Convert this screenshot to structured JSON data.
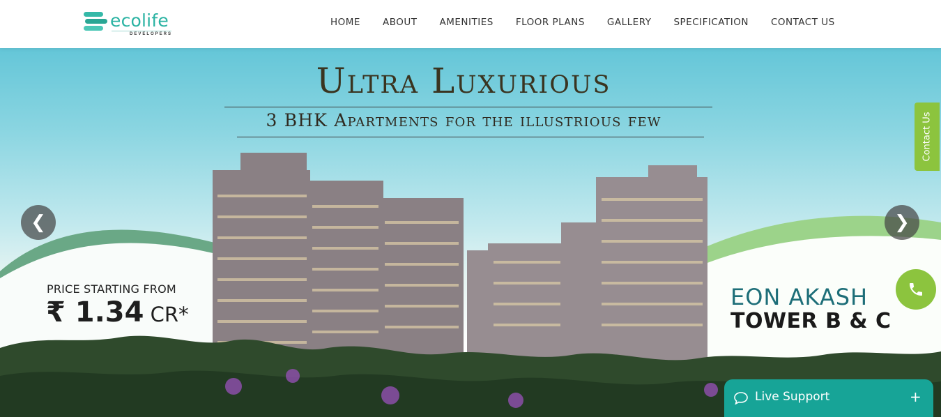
{
  "brand": {
    "name": "ecolife",
    "subtitle": "DEVELOPERS",
    "color": "#2bb3a3"
  },
  "nav": {
    "items": [
      {
        "label": "HOME"
      },
      {
        "label": "ABOUT"
      },
      {
        "label": "AMENITIES"
      },
      {
        "label": "FLOOR PLANS"
      },
      {
        "label": "GALLERY"
      },
      {
        "label": "SPECIFICATION"
      },
      {
        "label": "CONTACT US"
      }
    ]
  },
  "hero": {
    "title": "Ultra Luxurious",
    "subtitle": "3 BHK Apartments for the illustrious few",
    "price_label": "PRICE STARTING FROM",
    "price_amount": "₹ 1.34",
    "price_unit": " CR*",
    "tower_line1": "EON AKASH",
    "tower_line2": "TOWER B & C",
    "prev_icon": "chevron-left",
    "next_icon": "chevron-right",
    "prev_glyph": "❮",
    "next_glyph": "❯"
  },
  "side": {
    "contact_tab_label": "Contact Us",
    "accent_color": "#8cc43e",
    "phone_icon": "phone"
  },
  "live_support": {
    "label": "Live Support",
    "icon": "chat-bubble",
    "toggle_glyph": "+",
    "color": "#17a497"
  }
}
